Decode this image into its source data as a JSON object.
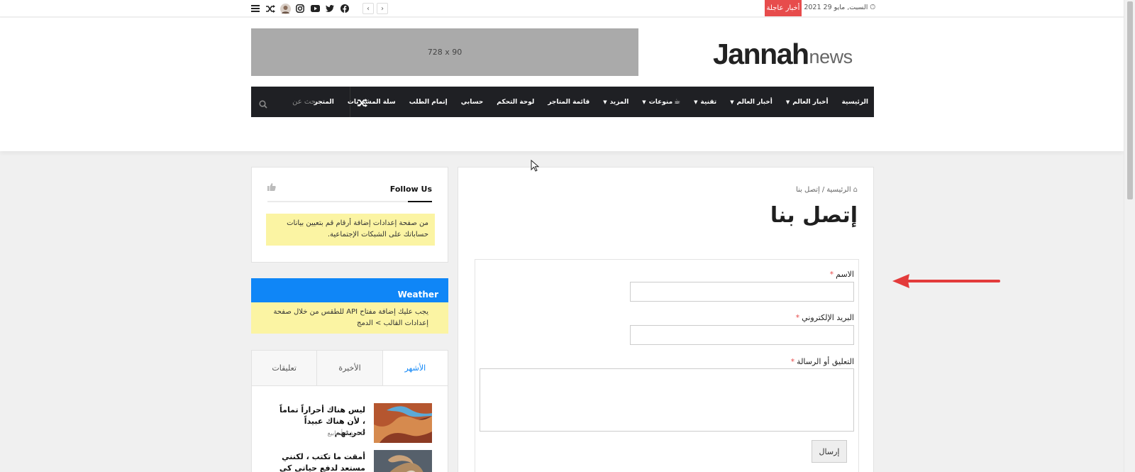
{
  "topbar": {
    "date": "السبت, مايو 29 2021",
    "breaking_label": "أخبار عاجلة",
    "social_icons": [
      "menu-icon",
      "shuffle-icon",
      "avatar",
      "instagram-icon",
      "youtube-icon",
      "twitter-icon",
      "facebook-icon"
    ],
    "prev_arrow": "‹",
    "next_arrow": "›"
  },
  "header": {
    "logo_main": "Jannah",
    "logo_sub": "news",
    "ad_label": "728 x 90"
  },
  "nav": {
    "search_placeholder": "بحث عن",
    "items": [
      {
        "label": "الرئيسية",
        "has_dropdown": false
      },
      {
        "label": "أخبار العالم",
        "has_dropdown": true
      },
      {
        "label": "أخبار العالم",
        "has_dropdown": true
      },
      {
        "label": "تقنية",
        "has_dropdown": true
      },
      {
        "label": "منوعات",
        "has_dropdown": true
      },
      {
        "label": "المزيد",
        "has_dropdown": true
      },
      {
        "label": "قائمة المتاجر",
        "has_dropdown": false
      },
      {
        "label": "لوحة التحكم",
        "has_dropdown": false
      },
      {
        "label": "حسابي",
        "has_dropdown": false
      },
      {
        "label": "إتمام الطلب",
        "has_dropdown": false
      },
      {
        "label": "سلة المشتريات",
        "has_dropdown": false
      },
      {
        "label": "المتجر",
        "has_dropdown": false
      }
    ]
  },
  "breadcrumb": {
    "home": "الرئيسية",
    "separator": "/",
    "current": "إتصل بنا"
  },
  "page_title": "إتصل بنا",
  "form": {
    "name_label": "الاسم",
    "email_label": "البريد الإلكتروني",
    "message_label": "التعليق أو الرسالة",
    "required_mark": "*",
    "name_value": "",
    "email_value": "",
    "message_value": "",
    "submit_label": "إرسال"
  },
  "sidebar": {
    "follow_title": "Follow Us",
    "follow_note": "من صفحة إعدادات إضافة أرقام قم بتعيين بيانات حساباتك على الشبكات الإجتماعية.",
    "weather_title": "Weather",
    "weather_note": "يجب عليك إضافة مفتاح API للطقس من خلال صفحة إعدادات القالب > الدمج",
    "tabs": [
      "تعليقات",
      "الأخيرة",
      "الأشهر"
    ],
    "posts": [
      {
        "title": "ليس هناك أحراراً تماماً ، لأن هناك عبيداً لحريتهم",
        "meta": "منذ 4 أسابيع"
      },
      {
        "title": "أمقت ما تكتب ، لكنني مستعد لدفع حياتي كي تواصل الكتابة",
        "meta": ""
      }
    ]
  },
  "colors": {
    "nav_bg": "#1f2024",
    "breaking_bg": "#e74c4c",
    "weather_bg": "#0f86f7",
    "note_bg": "#fbf4a3",
    "annotation_arrow": "#e33b3b"
  }
}
